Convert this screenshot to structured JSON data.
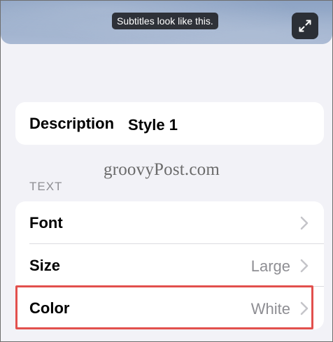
{
  "preview": {
    "subtitle_sample": "Subtitles look like this.",
    "expand_icon": "expand-arrows-icon"
  },
  "description": {
    "label": "Description",
    "value": "Style 1"
  },
  "watermark": "groovyPost.com",
  "text_section": {
    "header": "TEXT",
    "rows": [
      {
        "label": "Font",
        "value": ""
      },
      {
        "label": "Size",
        "value": "Large"
      },
      {
        "label": "Color",
        "value": "White"
      }
    ]
  },
  "colors": {
    "background": "#f2f2f7",
    "card": "#ffffff",
    "secondary_text": "#8e8e93",
    "highlight": "#e2504d"
  }
}
